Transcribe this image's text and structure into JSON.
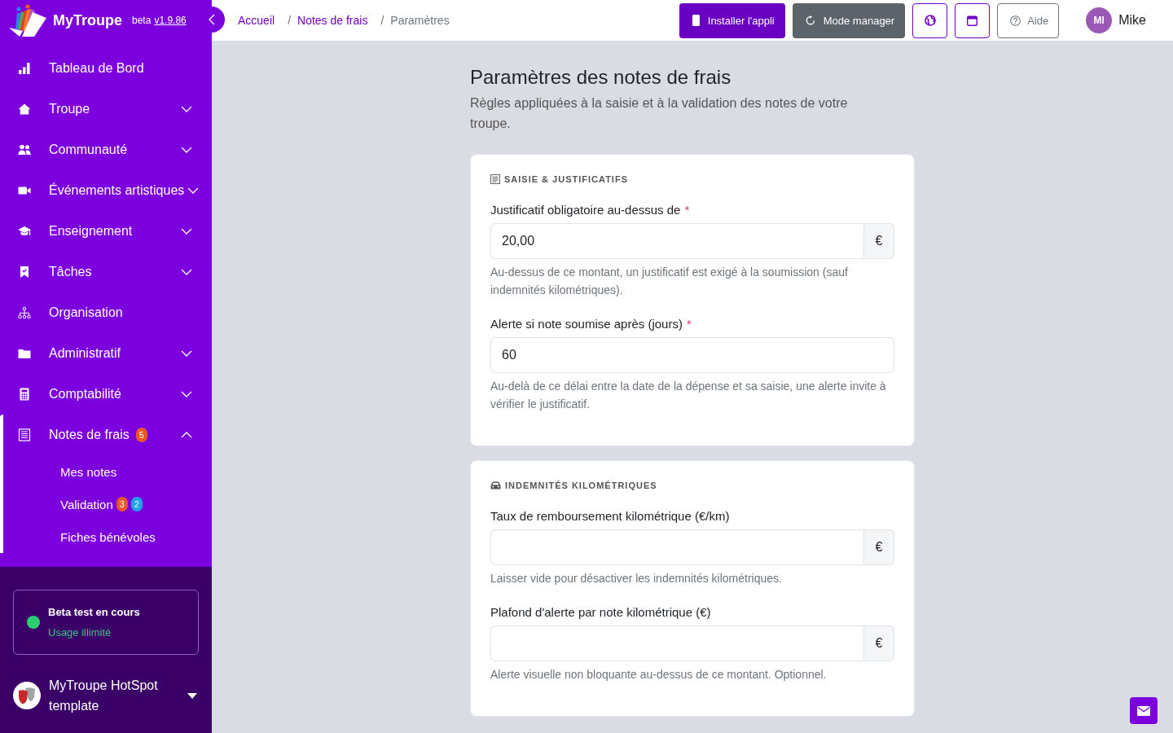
{
  "sidebar": {
    "brand": {
      "name": "MyTroupe",
      "tag": "beta",
      "version": "v1.9.86"
    },
    "items": [
      {
        "kind": "link",
        "label": "Tableau de Bord",
        "selected": false
      },
      {
        "kind": "group",
        "label": "Troupe",
        "selected": false,
        "expanded": false
      },
      {
        "kind": "group",
        "label": "Communauté",
        "selected": false,
        "expanded": false
      },
      {
        "kind": "group",
        "label": "Événements artistiques",
        "selected": false,
        "expanded": false
      },
      {
        "kind": "group",
        "label": "Enseignement",
        "selected": false,
        "expanded": false
      },
      {
        "kind": "group",
        "label": "Tâches",
        "selected": false,
        "expanded": false
      },
      {
        "kind": "link",
        "label": "Organisation",
        "selected": false
      },
      {
        "kind": "group",
        "label": "Administratif",
        "selected": false,
        "expanded": false
      },
      {
        "kind": "group",
        "label": "Comptabilité",
        "selected": false,
        "expanded": false
      },
      {
        "kind": "group",
        "label": "Notes de frais",
        "selected": true,
        "expanded": true,
        "badges": [
          {
            "text": "5",
            "color": "#e8562a"
          }
        ],
        "children": [
          {
            "label": "Mes notes"
          },
          {
            "label": "Validation",
            "badges": [
              {
                "text": "3",
                "color": "#e8562a"
              },
              {
                "text": "2",
                "color": "#1fa2e8"
              }
            ]
          },
          {
            "label": "Fiches bénévoles"
          }
        ]
      }
    ],
    "beta": {
      "title": "Beta test en cours",
      "subtitle": "Usage illimité"
    },
    "organization": {
      "name": "MyTroupe HotSpot template"
    }
  },
  "topbar": {
    "breadcrumb": [
      {
        "label": "Accueil",
        "current": false
      },
      {
        "separator": "/",
        "label": "Notes de frais",
        "current": false
      },
      {
        "separator": "/",
        "label": "Paramètres",
        "current": true
      }
    ],
    "buttons": [
      {
        "kind": "primary",
        "label": "Installer l'appli"
      },
      {
        "kind": "dark",
        "label": "Mode manager"
      },
      {
        "kind": "icon"
      },
      {
        "kind": "icon"
      },
      {
        "kind": "outline",
        "label": "Aide"
      }
    ],
    "user": {
      "initials": "MI",
      "name": "Mike"
    }
  },
  "page": {
    "title": "Paramètres des notes de frais",
    "subtitle": "Règles appliquées à la saisie et à la validation des notes de votre troupe.",
    "sections": [
      {
        "title": "SAISIE & JUSTIFICATIFS",
        "fields": [
          {
            "label": "Justificatif obligatoire au-dessus de",
            "required_mark": "*",
            "value": "20,00",
            "suffix": "€",
            "help": "Au-dessus de ce montant, un justificatif est exigé à la soumission (sauf indemnités kilométriques)."
          },
          {
            "label": "Alerte si note soumise après (jours)",
            "required_mark": "*",
            "value": "60",
            "help": "Au-delà de ce délai entre la date de la dépense et sa saisie, une alerte invite à vérifier le justificatif."
          }
        ]
      },
      {
        "title": "INDEMNITÉS KILOMÉTRIQUES",
        "fields": [
          {
            "label": "Taux de remboursement kilométrique (€/km)",
            "suffix": "€",
            "help": "Laisser vide pour désactiver les indemnités kilométriques."
          },
          {
            "label": "Plafond d'alerte par note kilométrique (€)",
            "suffix": "€",
            "help": "Alerte visuelle non bloquante au-dessus de ce montant. Optionnel."
          }
        ]
      }
    ]
  }
}
